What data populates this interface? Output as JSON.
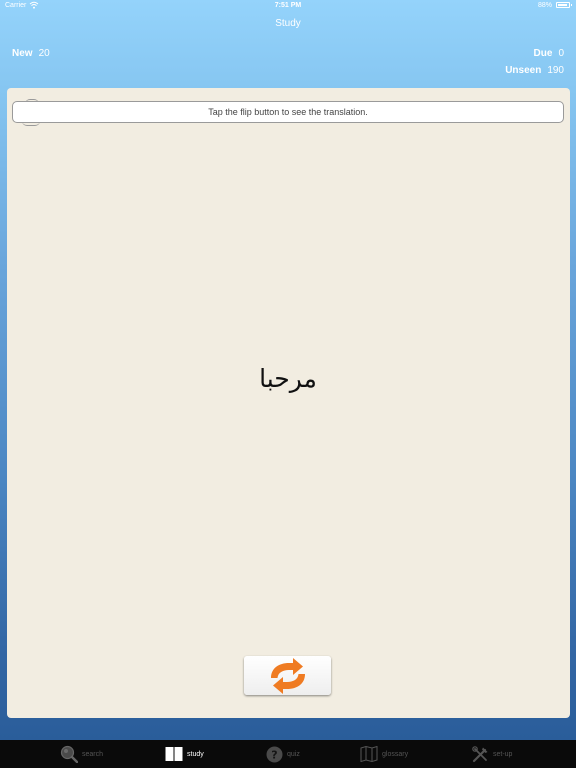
{
  "status_bar": {
    "carrier": "Carrier",
    "time": "7:51 PM",
    "battery": "88%"
  },
  "nav": {
    "title": "Study"
  },
  "stats": {
    "new_label": "New",
    "new_value": "20",
    "due_label": "Due",
    "due_value": "0",
    "unseen_label": "Unseen",
    "unseen_value": "190"
  },
  "card": {
    "hint": "Tap the flip button to see the translation.",
    "word": "مرحبا"
  },
  "flip_button": {
    "icon": "flip-arrows-icon",
    "color": "#ef7b22"
  },
  "tabs": [
    {
      "label": "search",
      "icon": "magnifier-icon",
      "active": false
    },
    {
      "label": "study",
      "icon": "book-icon",
      "active": true
    },
    {
      "label": "quiz",
      "icon": "question-icon",
      "active": false
    },
    {
      "label": "glossary",
      "icon": "map-icon",
      "active": false
    },
    {
      "label": "set-up",
      "icon": "tools-icon",
      "active": false
    }
  ],
  "colors": {
    "card_background": "#f2ede1",
    "tab_bar": "#0a0a0a",
    "accent": "#ef7b22"
  }
}
